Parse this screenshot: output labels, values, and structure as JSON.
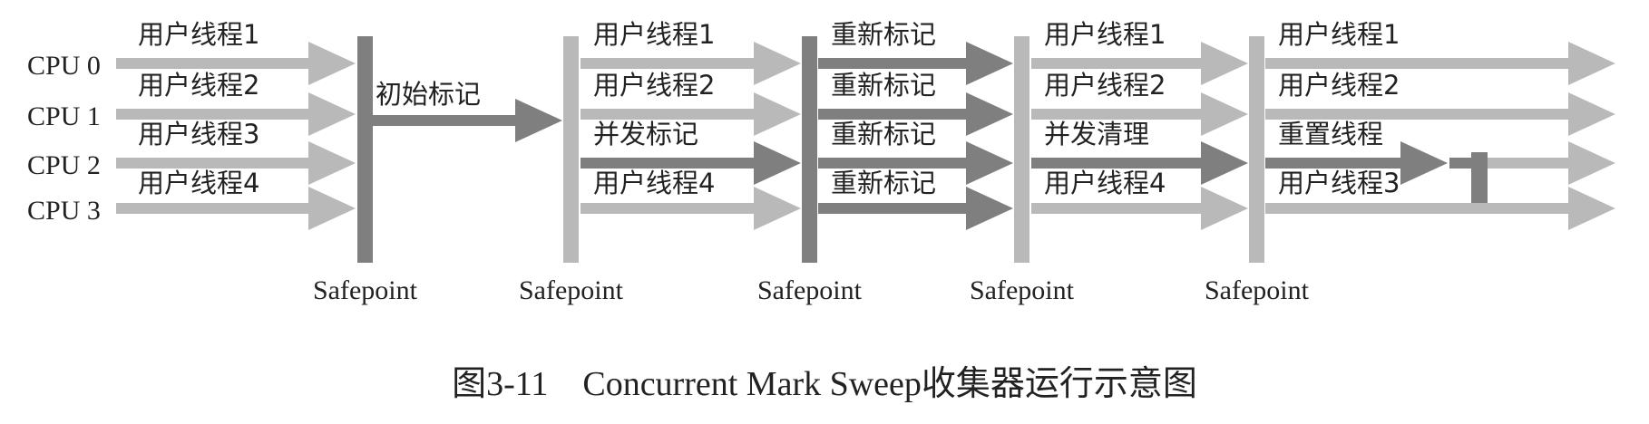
{
  "colors": {
    "light": "#b9b9b9",
    "dark": "#7f7f7f",
    "text": "#222222"
  },
  "cpus": [
    "CPU 0",
    "CPU 1",
    "CPU 2",
    "CPU 3"
  ],
  "safepoint_label": "Safepoint",
  "phases": [
    {
      "name": "initial",
      "arrows": [
        {
          "label": "用户线程1",
          "tone": "light"
        },
        {
          "label": "用户线程2",
          "tone": "light"
        },
        {
          "label": "用户线程3",
          "tone": "light"
        },
        {
          "label": "用户线程4",
          "tone": "light"
        }
      ]
    },
    {
      "name": "initial-mark",
      "arrows": [
        {
          "label": "初始标记",
          "tone": "dark"
        }
      ]
    },
    {
      "name": "concurrent-mark",
      "arrows": [
        {
          "label": "用户线程1",
          "tone": "light"
        },
        {
          "label": "用户线程2",
          "tone": "light"
        },
        {
          "label": "并发标记",
          "tone": "dark"
        },
        {
          "label": "用户线程4",
          "tone": "light"
        }
      ]
    },
    {
      "name": "remark",
      "arrows": [
        {
          "label": "重新标记",
          "tone": "dark"
        },
        {
          "label": "重新标记",
          "tone": "dark"
        },
        {
          "label": "重新标记",
          "tone": "dark"
        },
        {
          "label": "重新标记",
          "tone": "dark"
        }
      ]
    },
    {
      "name": "concurrent-sweep",
      "arrows": [
        {
          "label": "用户线程1",
          "tone": "light"
        },
        {
          "label": "用户线程2",
          "tone": "light"
        },
        {
          "label": "并发清理",
          "tone": "dark"
        },
        {
          "label": "用户线程4",
          "tone": "light"
        }
      ]
    },
    {
      "name": "concurrent-reset",
      "arrows": [
        {
          "label": "用户线程1",
          "tone": "light"
        },
        {
          "label": "用户线程2",
          "tone": "light"
        },
        {
          "label": "重置线程",
          "tone": "dark"
        },
        {
          "label": "用户线程3",
          "tone": "light"
        }
      ]
    }
  ],
  "safepoints": [
    {
      "tone": "dark"
    },
    {
      "tone": "light"
    },
    {
      "tone": "dark"
    },
    {
      "tone": "light"
    },
    {
      "tone": "light"
    }
  ],
  "caption": {
    "number": "图3-11",
    "text": "Concurrent Mark Sweep收集器运行示意图"
  }
}
